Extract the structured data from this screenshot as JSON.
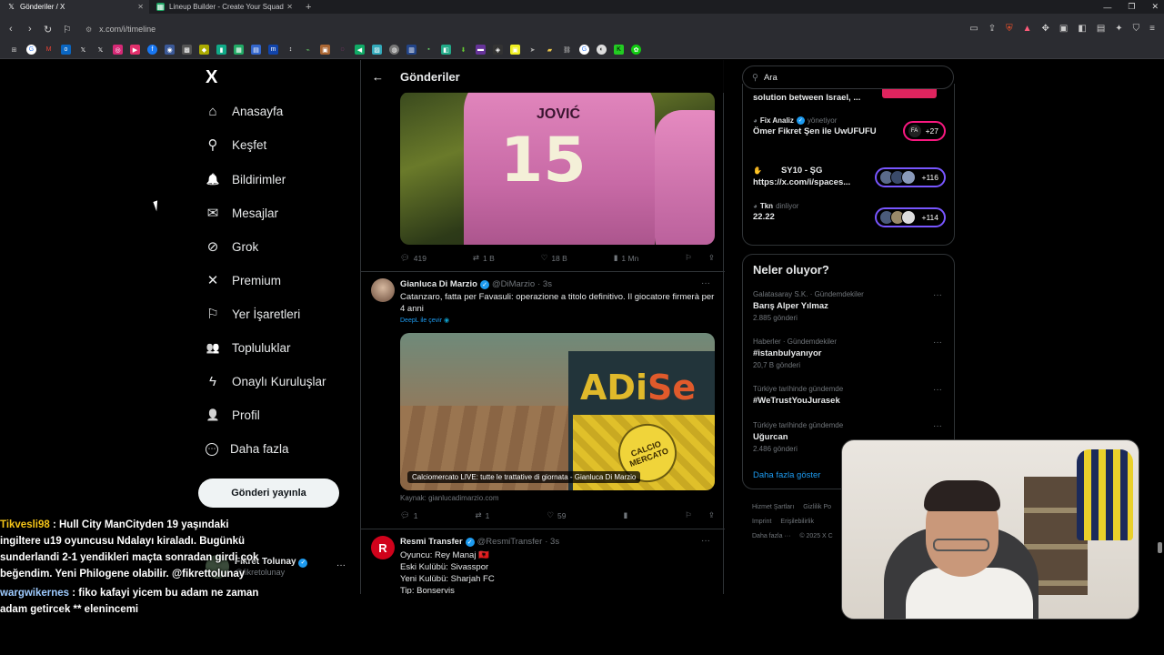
{
  "browser": {
    "tabs": [
      {
        "title": "Gönderiler / X",
        "icon": "x-logo-icon",
        "active": true
      },
      {
        "title": "Lineup Builder - Create Your Squad w",
        "icon": "sheet-icon",
        "active": false
      }
    ],
    "new_tab": "+",
    "url": "x.com/i/timeline"
  },
  "nav": {
    "logo": "X",
    "items": [
      {
        "label": "Anasayfa",
        "icon": "home-icon",
        "glyph": "⌂"
      },
      {
        "label": "Keşfet",
        "icon": "search-icon",
        "glyph": "⚲"
      },
      {
        "label": "Bildirimler",
        "icon": "bell-icon",
        "glyph": "🔔"
      },
      {
        "label": "Mesajlar",
        "icon": "mail-icon",
        "glyph": "✉"
      },
      {
        "label": "Grok",
        "icon": "grok-icon",
        "glyph": "⊘"
      },
      {
        "label": "Premium",
        "icon": "x-premium-icon",
        "glyph": "✕"
      },
      {
        "label": "Yer İşaretleri",
        "icon": "bookmark-icon",
        "glyph": "⚐"
      },
      {
        "label": "Topluluklar",
        "icon": "communities-icon",
        "glyph": "👥"
      },
      {
        "label": "Onaylı Kuruluşlar",
        "icon": "lightning-icon",
        "glyph": "ϟ"
      },
      {
        "label": "Profil",
        "icon": "profile-icon",
        "glyph": "👤"
      },
      {
        "label": "Daha fazla",
        "icon": "more-circle-icon",
        "glyph": "⋯"
      }
    ],
    "post_button": "Gönderi yayınla"
  },
  "feed": {
    "title": "Gönderiler",
    "post1": {
      "jersey_name": "JOVIĆ",
      "jersey_number": "15",
      "replies": "419",
      "reposts": "1 B",
      "likes": "18 B",
      "views": "1 Mn"
    },
    "post2": {
      "name": "Gianluca Di Marzio",
      "handle": "@DiMarzio",
      "time": "· 3s",
      "text": "Catanzaro, fatta per Favasuli: operazione a titolo definitivo. Il giocatore firmerà per 4 anni",
      "translate": "DeepL ile çevir",
      "media_logo_a": "ADi",
      "media_logo_b": "Se",
      "media_badge": "CALCIO MERCATO",
      "media_caption": "Calciomercato LIVE: tutte le trattative di giornata - Gianluca Di Marzio",
      "source": "Kaynak: gianlucadimarzio.com",
      "replies": "1",
      "reposts": "1",
      "likes": "59"
    },
    "post3": {
      "name": "Resmi Transfer",
      "handle": "@ResmiTransfer",
      "time": "· 3s",
      "lines": [
        "Oyuncu: Rey Manaj 🇦🇱",
        "Eski Kulübü: Sivasspor",
        "Yeni Kulübü: Sharjah FC",
        "Tip: Bonservis"
      ]
    }
  },
  "right": {
    "search_placeholder": "Ara",
    "spaces": [
      {
        "host": "",
        "role": "",
        "title": "solution between Israel, ...",
        "count": ""
      },
      {
        "host": "Fix Analiz",
        "role": "yönetiyor",
        "title": "Ömer Fikret Şen ile UwUFUFU",
        "count": "+27",
        "color": "#f91880"
      },
      {
        "host": "SY10 - ŞG",
        "role": "",
        "title": "https://x.com/i/spaces...",
        "count": "+116",
        "color": "#7856ff"
      },
      {
        "host": "Tkn",
        "role": "dinliyor",
        "title": "22.22",
        "count": "+114",
        "color": "#7856ff"
      }
    ],
    "trends_title": "Neler oluyor?",
    "trends": [
      {
        "meta": "Galatasaray S.K. · Gündemdekiler",
        "name": "Barış Alper Yılmaz",
        "count": "2.885 gönderi"
      },
      {
        "meta": "Haberler · Gündemdekiler",
        "name": "#istanbulyanıyor",
        "count": "20,7 B gönderi"
      },
      {
        "meta": "Türkiye tarihinde gündemde",
        "name": "#WeTrustYouJurasek",
        "count": ""
      },
      {
        "meta": "Türkiye tarihinde gündemde",
        "name": "Uğurcan",
        "count": "2.486 gönderi"
      }
    ],
    "show_more": "Daha fazla göster",
    "footer": [
      "Hizmet Şartları",
      "Gizlilik Po",
      "Imprint",
      "Erişilebilirlik",
      "Daha fazla ···",
      "© 2025 X C"
    ]
  },
  "overlay": {
    "chat": [
      {
        "user": "Tikvesli98",
        "text": " : Hull City ManCityden 19 yaşındaki ingiltere u19 oyuncusu       Ndalayı kiraladı. Bugünkü sunderlandi 2-1 yendikleri maçta sonradan girdi çok beğendim. Yeni Philogene olabilir. @fikrettolunay",
        "color": "#f5c518"
      },
      {
        "user": "wargwikernes",
        "text": " : fiko kafayi yicem bu adam ne zaman adam getircek ** elenincemi",
        "color": "#9ecbff"
      }
    ],
    "fik_name": "Fikret Tolunay",
    "fik_handle": "@fikretolunay"
  },
  "colors": {
    "accent": "#1d9bf0",
    "bg": "#000000",
    "text": "#e7e9ea",
    "muted": "#71767b"
  }
}
